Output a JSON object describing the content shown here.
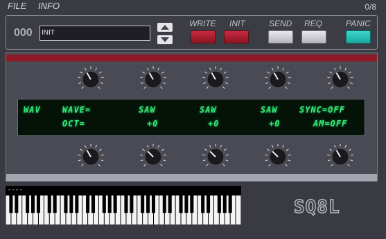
{
  "menubar": {
    "file": "FILE",
    "info": "INFO",
    "page_indicator": "0/8"
  },
  "patch": {
    "number": "000",
    "name": "INIT"
  },
  "buttons": {
    "write": "WRITE",
    "init": "INIT",
    "send": "SEND",
    "req": "REQ",
    "panic": "PANIC"
  },
  "lcd": {
    "row1": [
      "WAV",
      "WAVE=",
      "SAW",
      "SAW",
      "SAW",
      "SYNC=OFF"
    ],
    "row2": [
      "OCT=",
      "+0",
      "+0",
      "+0",
      "AM=OFF"
    ]
  },
  "keyboard": {
    "label": "----"
  },
  "logo": {
    "text": "SQ8L"
  },
  "colors": {
    "accent_red": "#8e1a28",
    "lcd_green": "#35e878",
    "panic_teal": "#2cc2b8",
    "background": "#3a3a42"
  },
  "icons": {
    "up": "arrow-up-icon",
    "down": "arrow-down-icon",
    "knob": "knob-icon"
  }
}
